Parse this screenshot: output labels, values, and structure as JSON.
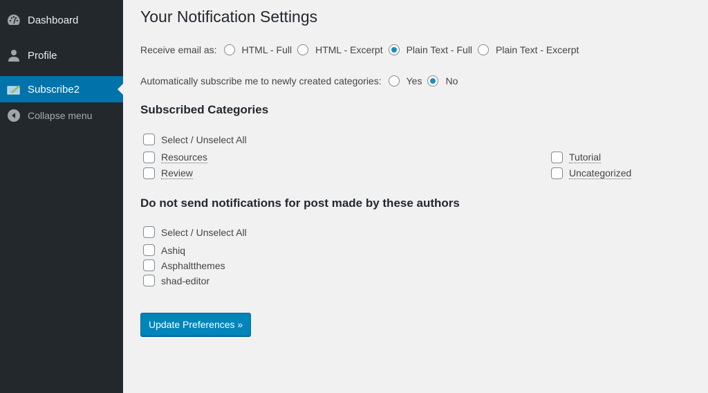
{
  "sidebar": {
    "items": [
      {
        "label": "Dashboard",
        "icon": "dashboard-icon"
      },
      {
        "label": "Profile",
        "icon": "user-icon"
      },
      {
        "label": "Subscribe2",
        "icon": "subscribe2-icon",
        "active": true
      },
      {
        "label": "Collapse menu",
        "icon": "collapse-arrow-icon"
      }
    ]
  },
  "page": {
    "title": "Your Notification Settings",
    "email_format": {
      "label": "Receive email as:",
      "options": [
        "HTML - Full",
        "HTML - Excerpt",
        "Plain Text - Full",
        "Plain Text - Excerpt"
      ],
      "selected": "Plain Text - Full"
    },
    "auto_subscribe": {
      "label": "Automatically subscribe me to newly created categories:",
      "options": [
        "Yes",
        "No"
      ],
      "selected": "No"
    },
    "categories": {
      "heading": "Subscribed Categories",
      "select_all": "Select / Unselect All",
      "items": [
        "Resources",
        "Review",
        "Tutorial",
        "Uncategorized"
      ]
    },
    "authors": {
      "heading": "Do not send notifications for post made by these authors",
      "select_all": "Select / Unselect All",
      "items": [
        "Ashiq",
        "Asphaltthemes",
        "shad-editor"
      ]
    },
    "submit_label": "Update Preferences »"
  },
  "colors": {
    "sidebar_bg": "#23282d",
    "accent": "#0073aa",
    "button": "#0085ba",
    "page_bg": "#f1f1f1"
  }
}
